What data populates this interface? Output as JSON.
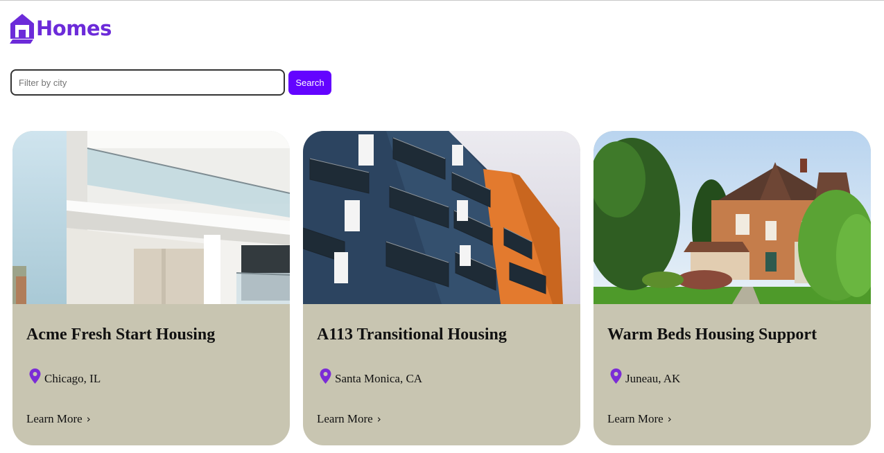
{
  "brand": {
    "name": "Homes",
    "color": "#6c2bd9"
  },
  "search": {
    "placeholder": "Filter by city",
    "value": "",
    "button_label": "Search",
    "button_color": "#6304ff"
  },
  "listings": [
    {
      "title": "Acme Fresh Start Housing",
      "location": "Chicago, IL",
      "link_label": "Learn More",
      "link_icon": "chevron-right-icon"
    },
    {
      "title": "A113 Transitional Housing",
      "location": "Santa Monica, CA",
      "link_label": "Learn More",
      "link_icon": "chevron-right-icon"
    },
    {
      "title": "Warm Beds Housing Support",
      "location": "Juneau, AK",
      "link_label": "Learn More",
      "link_icon": "chevron-right-icon"
    }
  ],
  "card_color": "#c8c5b1",
  "pin_color": "#7b2cd6"
}
